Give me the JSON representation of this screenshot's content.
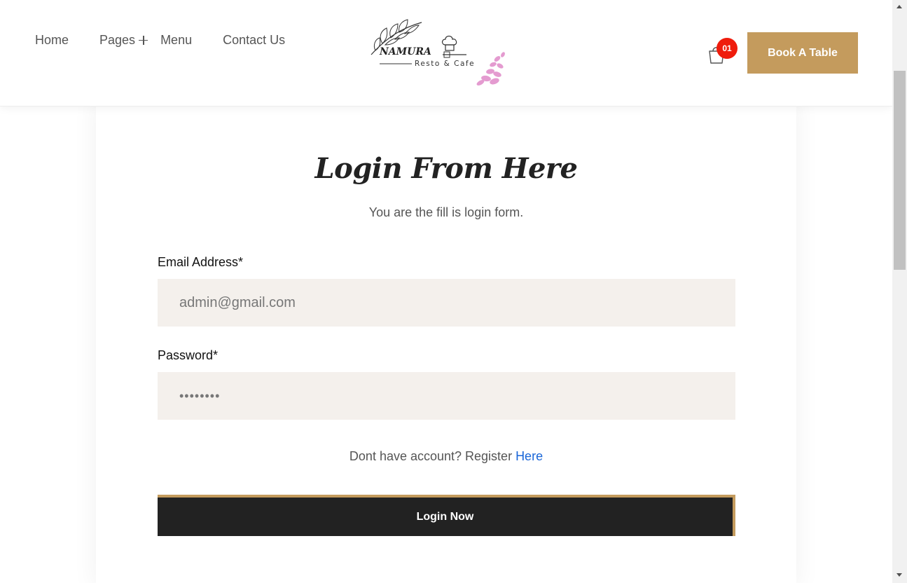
{
  "header": {
    "nav": {
      "home": "Home",
      "pages": "Pages",
      "menu": "Menu",
      "contact": "Contact Us"
    },
    "logo": {
      "brand": "NAMURA",
      "tagline": "Resto & Cafe"
    },
    "cart_count": "01",
    "book_button": "Book A Table"
  },
  "login": {
    "title": "Login From Here",
    "subtitle": "You are the fill is login form.",
    "email_label": "Email Address*",
    "email_placeholder": "admin@gmail.com",
    "password_label": "Password*",
    "password_value": "••••••••",
    "register_text": "Dont have account? Register ",
    "register_link": "Here",
    "submit": "Login Now"
  },
  "colors": {
    "accent": "#c49b5d",
    "badge": "#ef1c0c",
    "dark": "#222222",
    "input_bg": "#f4f0ec",
    "link": "#1a66d8"
  }
}
